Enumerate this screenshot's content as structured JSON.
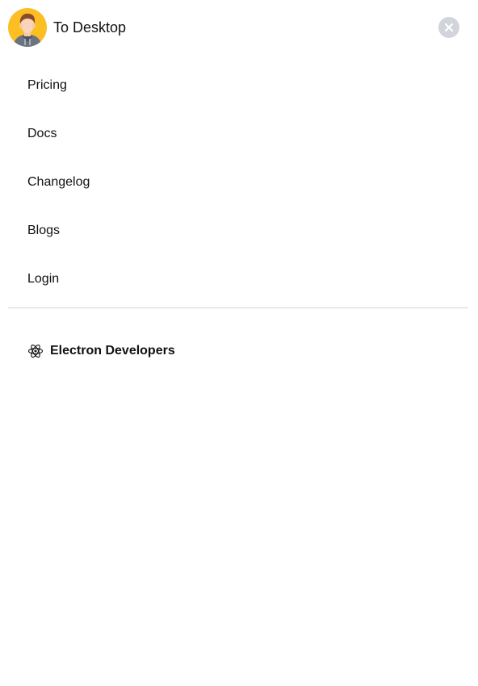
{
  "header": {
    "brand_label": "To Desktop",
    "logo_icon": "avatar-icon",
    "close_icon": "close-icon"
  },
  "nav": {
    "items": [
      {
        "label": "Pricing"
      },
      {
        "label": "Docs"
      },
      {
        "label": "Changelog"
      },
      {
        "label": "Blogs"
      },
      {
        "label": "Login"
      }
    ]
  },
  "promo": {
    "icon": "electron-icon",
    "label": "Electron Developers"
  },
  "colors": {
    "background": "#ffffff",
    "text": "#111111",
    "close_button_bg": "#d1d5db",
    "divider": "#d4d4d4",
    "avatar_bg": "#fbbf24"
  }
}
